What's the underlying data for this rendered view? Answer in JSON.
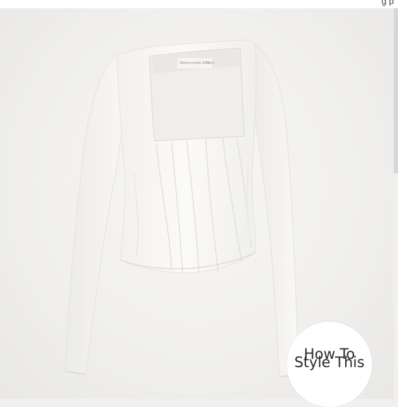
{
  "header": {
    "partial_text": "g     p"
  },
  "product": {
    "label_line1": "Abercrombie & Fitch",
    "label_line2": "XS"
  },
  "badge": {
    "line1": "How To",
    "line2": "Style This"
  }
}
